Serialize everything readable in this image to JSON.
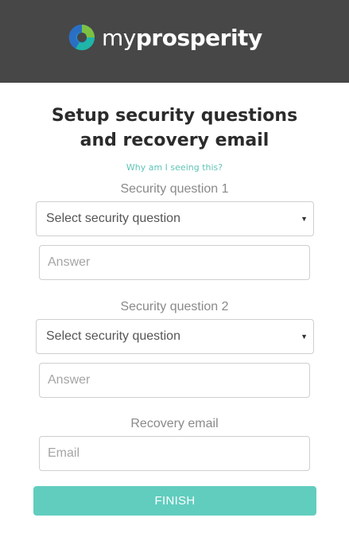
{
  "header": {
    "logo_text_regular": "my",
    "logo_text_bold": "prosperity",
    "logo_mark_icon": "myprosperity-logo-icon",
    "background_color": "#474747"
  },
  "title": {
    "line1": "Setup security questions",
    "line2": "and recovery email"
  },
  "why_link": "Why am I seeing this?",
  "question1": {
    "label": "Security question 1",
    "select_value": "Select security question",
    "answer_placeholder": "Answer"
  },
  "question2": {
    "label": "Security question 2",
    "select_value": "Select security question",
    "answer_placeholder": "Answer"
  },
  "recovery": {
    "label": "Recovery email",
    "email_placeholder": "Email"
  },
  "finish_button": "FINISH",
  "colors": {
    "accent": "#61cdbf",
    "link": "#5ec4b6"
  }
}
